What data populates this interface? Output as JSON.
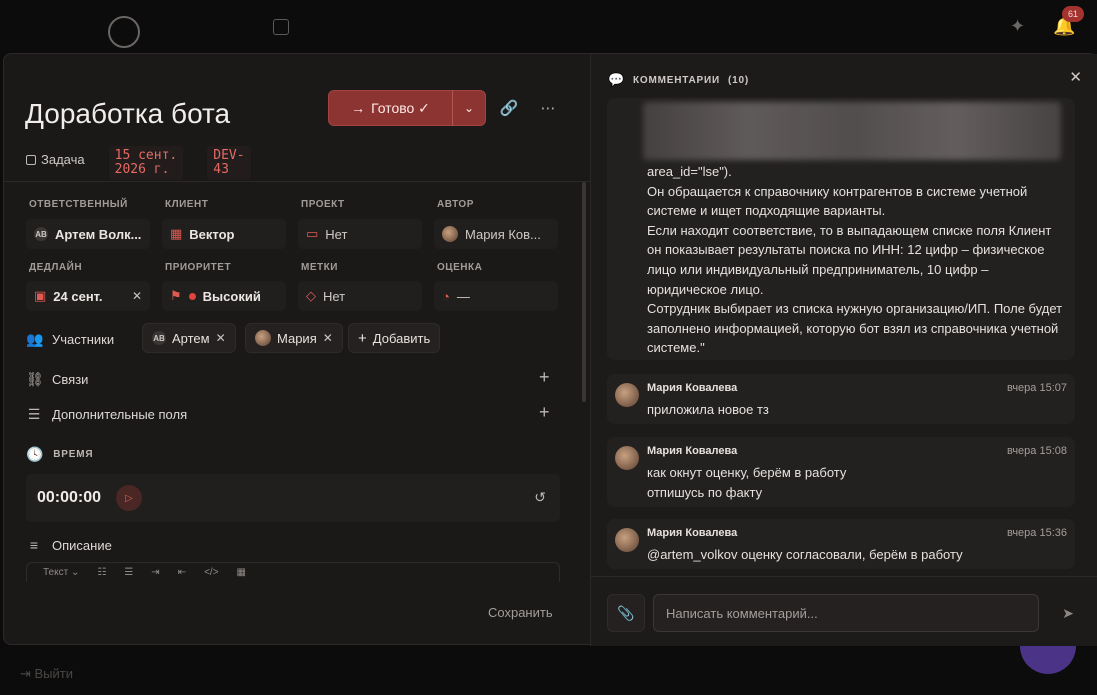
{
  "background": {
    "notifications_badge": "61",
    "exit_label": "Выйти"
  },
  "task": {
    "title": "Доработка бота",
    "status_button": "Готово ✓",
    "type_label": "Задача",
    "date_line1": "15 сент.",
    "date_line2": "2026 г.",
    "key_line1": "DEV-",
    "key_line2": "43"
  },
  "fields": {
    "assignee": {
      "label": "ОТВЕТСТВЕННЫЙ",
      "initials": "AB",
      "value": "Артем Волк..."
    },
    "client": {
      "label": "КЛИЕНТ",
      "value": "Вектор"
    },
    "project": {
      "label": "ПРОЕКТ",
      "value": "Нет"
    },
    "author": {
      "label": "АВТОР",
      "value": "Мария Ков..."
    },
    "deadline": {
      "label": "ДЕДЛАЙН",
      "value": "24 сент."
    },
    "priority": {
      "label": "ПРИОРИТЕТ",
      "value": "Высокий"
    },
    "tags": {
      "label": "МЕТКИ",
      "value": "Нет"
    },
    "estimate": {
      "label": "ОЦЕНКА",
      "value": "—"
    }
  },
  "participants": {
    "label": "Участники",
    "items": [
      {
        "initials": "AB",
        "name": "Артем"
      },
      {
        "name": "Мария"
      }
    ],
    "add_label": "Добавить"
  },
  "links_label": "Связи",
  "extra_fields_label": "Дополнительные поля",
  "time": {
    "heading": "ВРЕМЯ",
    "value": "00:00:00"
  },
  "description": {
    "label": "Описание",
    "toolbar_text": "Текст"
  },
  "save_label": "Сохранить",
  "comments": {
    "heading": "КОММЕНТАРИИ",
    "count": "(10)",
    "long_message": [
      "area_id=\"lse\").",
      "Он обращается к справочнику контрагентов в системе учетной системе и ищет подходящие варианты.",
      "Если находит соответствие, то в выпадающем списке поля Клиент он показывает результаты поиска по ИНН: 12 цифр – физическое лицо или индивидуальный предприниматель, 10 цифр – юридическое лицо.",
      "Сотрудник выбирает из списка нужную организацию/ИП. Поле будет заполнено информацией, которую бот взял из справочника учетной системе.\""
    ],
    "messages": [
      {
        "author": "Мария Ковалева",
        "time": "вчера 15:07",
        "line1": "приложила новое тз",
        "line2": ""
      },
      {
        "author": "Мария Ковалева",
        "time": "вчера 15:08",
        "line1": "как окнут оценку, берём в работу",
        "line2": "отпишусь по факту"
      },
      {
        "author": "Мария Ковалева",
        "time": "вчера 15:36",
        "line1": "@artem_volkov оценку согласовали, берём в работу",
        "line2": ""
      }
    ],
    "input_placeholder": "Написать комментарий..."
  }
}
